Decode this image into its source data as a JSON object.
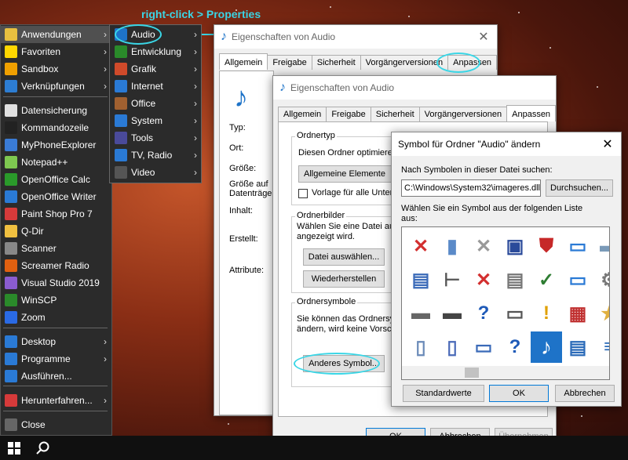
{
  "annotation": "right-click > Properties",
  "start_menu": {
    "items": [
      "Anwendungen",
      "Favoriten",
      "Sandbox",
      "Verknüpfungen",
      "Datensicherung",
      "Kommandozeile",
      "MyPhoneExplorer",
      "Notepad++",
      "OpenOffice Calc",
      "OpenOffice Writer",
      "Paint Shop Pro 7",
      "Q-Dir",
      "Scanner",
      "Screamer Radio",
      "Visual Studio 2019",
      "WinSCP",
      "Zoom",
      "Desktop",
      "Programme",
      "Ausführen...",
      "Herunterfahren...",
      "Close"
    ]
  },
  "submenu": {
    "items": [
      "Audio",
      "Entwicklung",
      "Grafik",
      "Internet",
      "Office",
      "System",
      "Tools",
      "TV, Radio",
      "Video"
    ]
  },
  "win1": {
    "title": "Eigenschaften von Audio",
    "tabs": [
      "Allgemein",
      "Freigabe",
      "Sicherheit",
      "Vorgängerversionen",
      "Anpassen"
    ],
    "fields": [
      "Typ:",
      "Ort:",
      "Größe:",
      "Größe auf Datenträger:",
      "Inhalt:",
      "Erstellt:",
      "Attribute:"
    ]
  },
  "win2": {
    "title": "Eigenschaften von Audio",
    "tabs": [
      "Allgemein",
      "Freigabe",
      "Sicherheit",
      "Vorgängerversionen",
      "Anpassen"
    ],
    "ordnertyp": {
      "title": "Ordnertyp",
      "text": "Diesen Ordner optimieren",
      "select": "Allgemeine Elemente",
      "checkbox": "Vorlage für alle Unterordner"
    },
    "ordnerbilder": {
      "title": "Ordnerbilder",
      "text1": "Wählen Sie eine Datei au",
      "text2": "angezeigt wird.",
      "btn1": "Datei auswählen...",
      "btn2": "Wiederherstellen"
    },
    "ordnersymbole": {
      "title": "Ordnersymbole",
      "text1": "Sie können das Ordnersym",
      "text2": "ändern, wird keine Vorsch",
      "btn": "Anderes Symbol..."
    },
    "ok": "OK",
    "cancel": "Abbrechen",
    "apply": "Übernehmen"
  },
  "win3": {
    "title": "Symbol für Ordner \"Audio\" ändern",
    "search_label": "Nach Symbolen in dieser Datei suchen:",
    "path": "C:\\Windows\\System32\\imageres.dll",
    "browse": "Durchsuchen...",
    "list_label1": "Wählen Sie ein Symbol aus der folgenden Liste",
    "list_label2": "aus:",
    "standard": "Standardwerte",
    "ok": "OK",
    "cancel": "Abbrechen"
  }
}
